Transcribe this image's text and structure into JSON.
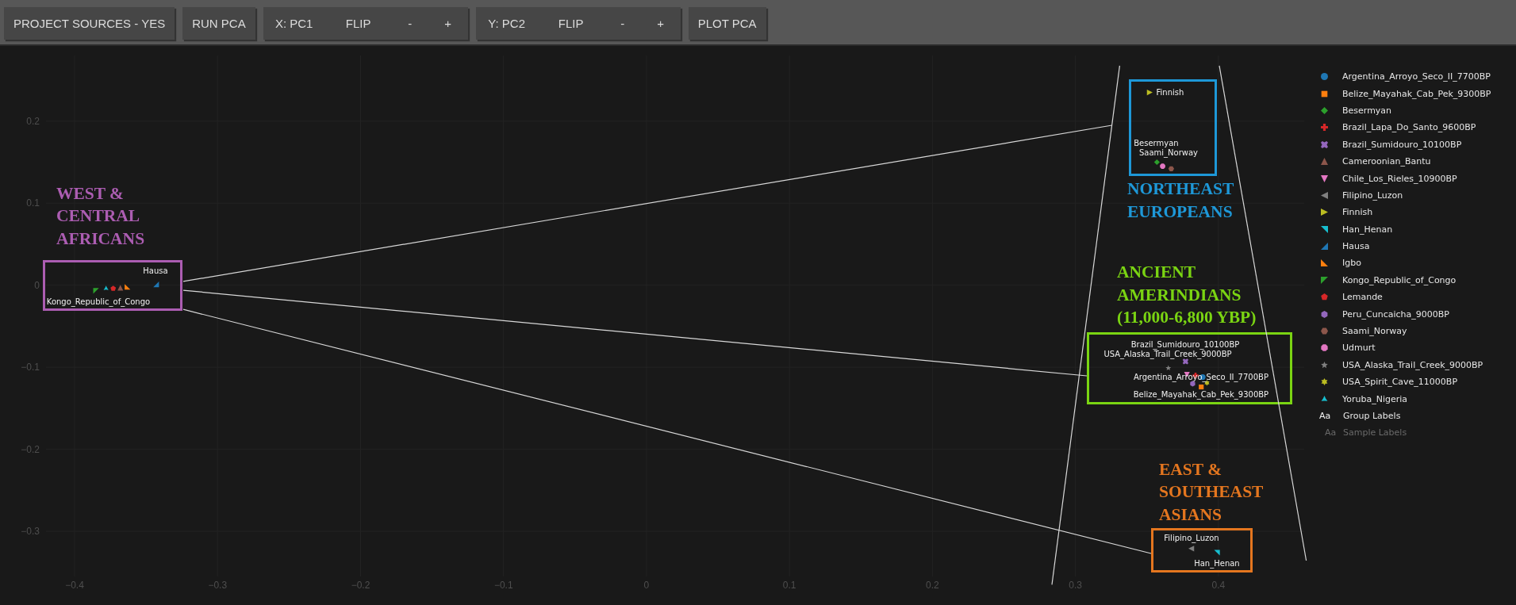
{
  "toolbar": {
    "items": [
      {
        "kind": "button",
        "label": "PROJECT SOURCES - YES"
      },
      {
        "kind": "button",
        "label": "RUN PCA"
      },
      {
        "kind": "axis",
        "selector": "X: PC1",
        "actions": [
          "FLIP",
          "-",
          "+"
        ]
      },
      {
        "kind": "axis",
        "selector": "Y: PC2",
        "actions": [
          "FLIP",
          "-",
          "+"
        ]
      },
      {
        "kind": "button",
        "label": "PLOT PCA"
      }
    ]
  },
  "plot": {
    "chart_data": {
      "type": "scatter",
      "grid": true,
      "xlim": [
        -0.42,
        0.46
      ],
      "ylim": [
        -0.355,
        0.28
      ],
      "xticks": [
        {
          "value": -0.4,
          "label": "−0.4"
        },
        {
          "value": -0.3,
          "label": "−0.3"
        },
        {
          "value": -0.2,
          "label": "−0.2"
        },
        {
          "value": -0.1,
          "label": "−0.1"
        },
        0,
        0.1,
        0.2,
        0.3,
        0.4
      ],
      "yticks": [
        {
          "value": -0.3,
          "label": "−0.3"
        },
        {
          "value": -0.2,
          "label": "−0.2"
        },
        {
          "value": -0.1,
          "label": "−0.1"
        },
        0,
        0.1,
        0.2
      ],
      "series": [
        {
          "name": "Argentina_Arroyo_Seco_II_7700BP",
          "color": "#1f77b4",
          "x": [
            0.389
          ],
          "values": [
            -0.112
          ]
        },
        {
          "name": "Belize_Mayahak_Cab_Pek_9300BP",
          "color": "#ff7f0e",
          "x": [
            0.388
          ],
          "values": [
            -0.124
          ]
        },
        {
          "name": "Besermyan",
          "color": "#2ca02c",
          "x": [
            0.357
          ],
          "values": [
            0.15
          ]
        },
        {
          "name": "Brazil_Lapa_Do_Santo_9600BP",
          "color": "#d62728",
          "x": [
            0.384
          ],
          "values": [
            -0.11
          ]
        },
        {
          "name": "Brazil_Sumidouro_10100BP",
          "color": "#9467bd",
          "x": [
            0.377
          ],
          "values": [
            -0.093
          ]
        },
        {
          "name": "Cameroonian_Bantu",
          "color": "#8c564b",
          "x": [
            -0.368
          ],
          "values": [
            -0.003
          ]
        },
        {
          "name": "Chile_Los_Rieles_10900BP",
          "color": "#e377c2",
          "x": [
            0.378
          ],
          "values": [
            -0.109
          ]
        },
        {
          "name": "Filipino_Luzon",
          "color": "#7f7f7f",
          "x": [
            0.381
          ],
          "values": [
            -0.321
          ]
        },
        {
          "name": "Finnish",
          "color": "#bcbd22",
          "x": [
            0.352
          ],
          "values": [
            0.235
          ]
        },
        {
          "name": "Han_Henan",
          "color": "#17becf",
          "x": [
            0.399
          ],
          "values": [
            -0.326
          ]
        },
        {
          "name": "Hausa",
          "color": "#1f77b4",
          "x": [
            -0.343
          ],
          "values": [
            0.001
          ]
        },
        {
          "name": "Igbo",
          "color": "#ff7f0e",
          "x": [
            -0.363
          ],
          "values": [
            -0.002
          ]
        },
        {
          "name": "Kongo_Republic_of_Congo",
          "color": "#2ca02c",
          "x": [
            -0.385
          ],
          "values": [
            -0.007
          ]
        },
        {
          "name": "Lemande",
          "color": "#d62728",
          "x": [
            -0.373
          ],
          "values": [
            -0.004
          ]
        },
        {
          "name": "Peru_Cuncaicha_9000BP",
          "color": "#9467bd",
          "x": [
            0.382
          ],
          "values": [
            -0.12
          ]
        },
        {
          "name": "Saami_Norway",
          "color": "#8c564b",
          "x": [
            0.367
          ],
          "values": [
            0.142
          ]
        },
        {
          "name": "Udmurt",
          "color": "#e377c2",
          "x": [
            0.361
          ],
          "values": [
            0.145
          ]
        },
        {
          "name": "USA_Alaska_Trail_Creek_9000BP",
          "color": "#7f7f7f",
          "x": [
            0.365
          ],
          "values": [
            -0.101
          ]
        },
        {
          "name": "USA_Spirit_Cave_11000BP",
          "color": "#bcbd22",
          "x": [
            0.392
          ],
          "values": [
            -0.119
          ]
        },
        {
          "name": "Yoruba_Nigeria",
          "color": "#17becf",
          "x": [
            -0.378
          ],
          "values": [
            -0.004
          ]
        }
      ]
    },
    "markers": [
      {
        "kind": "circle",
        "labelled": true
      },
      {
        "kind": "square",
        "labelled": true
      },
      {
        "kind": "diamond",
        "labelled": true
      },
      {
        "kind": "cross",
        "labelled": false
      },
      {
        "kind": "x",
        "labelled": true
      },
      {
        "kind": "triangle-up",
        "labelled": false
      },
      {
        "kind": "triangle-down",
        "labelled": false
      },
      {
        "kind": "triangle-left",
        "labelled": true
      },
      {
        "kind": "triangle-right",
        "labelled": true
      },
      {
        "kind": "triangle-ne",
        "labelled": true
      },
      {
        "kind": "triangle-se",
        "labelled": true
      },
      {
        "kind": "triangle-sw",
        "labelled": false
      },
      {
        "kind": "triangle-nw",
        "labelled": true
      },
      {
        "kind": "pentagon",
        "labelled": false
      },
      {
        "kind": "hexagon",
        "labelled": false
      },
      {
        "kind": "hexagon2",
        "labelled": true
      },
      {
        "kind": "octagon",
        "labelled": false
      },
      {
        "kind": "star",
        "labelled": true
      },
      {
        "kind": "hexagram",
        "labelled": false
      },
      {
        "kind": "star-triangle-up",
        "labelled": false
      }
    ],
    "regions": [
      {
        "title": "WEST & CENTRAL AFRICANS",
        "color": "#ac5db2"
      },
      {
        "title": "NORTHEAST EUROPEANS",
        "color": "#1e98d8"
      },
      {
        "title": "ANCIENT AMERINDIANS (11,000-6,800 YBP)",
        "color": "#7ad412"
      },
      {
        "title": "EAST & SOUTHEAST ASIANS",
        "color": "#e4761f"
      }
    ],
    "legend_toggles": [
      {
        "kind": "group",
        "glyph": "Aa",
        "label": "Group Labels",
        "on": true
      },
      {
        "kind": "sample",
        "glyph": "Aa",
        "label": "Sample Labels",
        "on": false
      }
    ]
  }
}
